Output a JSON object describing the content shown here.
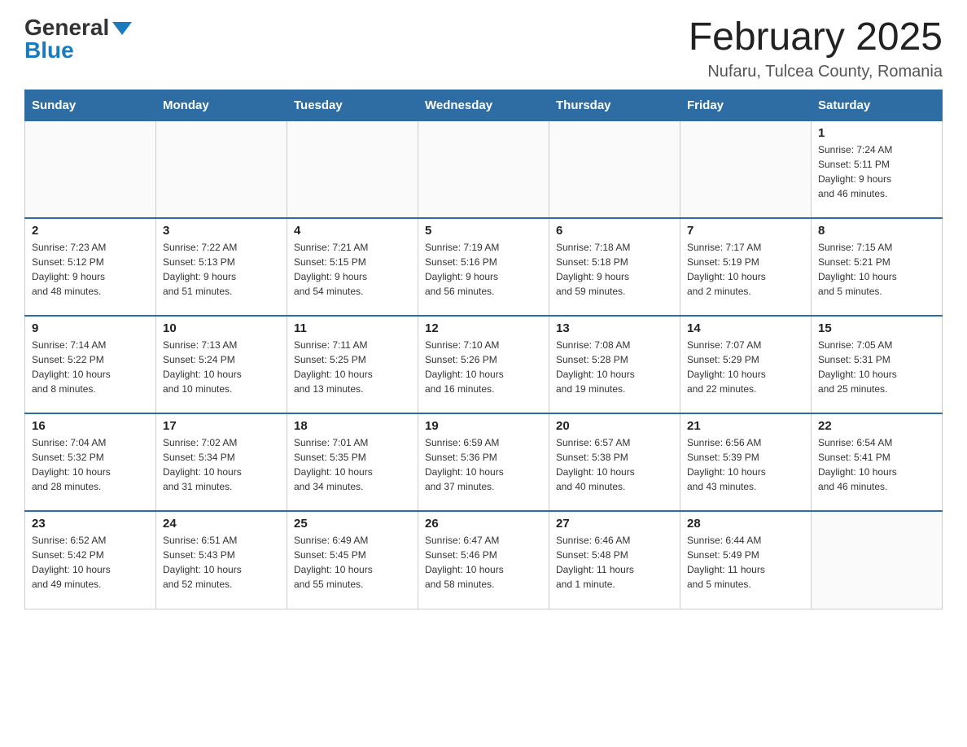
{
  "logo": {
    "general": "General",
    "blue": "Blue"
  },
  "title": "February 2025",
  "location": "Nufaru, Tulcea County, Romania",
  "weekdays": [
    "Sunday",
    "Monday",
    "Tuesday",
    "Wednesday",
    "Thursday",
    "Friday",
    "Saturday"
  ],
  "weeks": [
    [
      {
        "day": "",
        "info": ""
      },
      {
        "day": "",
        "info": ""
      },
      {
        "day": "",
        "info": ""
      },
      {
        "day": "",
        "info": ""
      },
      {
        "day": "",
        "info": ""
      },
      {
        "day": "",
        "info": ""
      },
      {
        "day": "1",
        "info": "Sunrise: 7:24 AM\nSunset: 5:11 PM\nDaylight: 9 hours\nand 46 minutes."
      }
    ],
    [
      {
        "day": "2",
        "info": "Sunrise: 7:23 AM\nSunset: 5:12 PM\nDaylight: 9 hours\nand 48 minutes."
      },
      {
        "day": "3",
        "info": "Sunrise: 7:22 AM\nSunset: 5:13 PM\nDaylight: 9 hours\nand 51 minutes."
      },
      {
        "day": "4",
        "info": "Sunrise: 7:21 AM\nSunset: 5:15 PM\nDaylight: 9 hours\nand 54 minutes."
      },
      {
        "day": "5",
        "info": "Sunrise: 7:19 AM\nSunset: 5:16 PM\nDaylight: 9 hours\nand 56 minutes."
      },
      {
        "day": "6",
        "info": "Sunrise: 7:18 AM\nSunset: 5:18 PM\nDaylight: 9 hours\nand 59 minutes."
      },
      {
        "day": "7",
        "info": "Sunrise: 7:17 AM\nSunset: 5:19 PM\nDaylight: 10 hours\nand 2 minutes."
      },
      {
        "day": "8",
        "info": "Sunrise: 7:15 AM\nSunset: 5:21 PM\nDaylight: 10 hours\nand 5 minutes."
      }
    ],
    [
      {
        "day": "9",
        "info": "Sunrise: 7:14 AM\nSunset: 5:22 PM\nDaylight: 10 hours\nand 8 minutes."
      },
      {
        "day": "10",
        "info": "Sunrise: 7:13 AM\nSunset: 5:24 PM\nDaylight: 10 hours\nand 10 minutes."
      },
      {
        "day": "11",
        "info": "Sunrise: 7:11 AM\nSunset: 5:25 PM\nDaylight: 10 hours\nand 13 minutes."
      },
      {
        "day": "12",
        "info": "Sunrise: 7:10 AM\nSunset: 5:26 PM\nDaylight: 10 hours\nand 16 minutes."
      },
      {
        "day": "13",
        "info": "Sunrise: 7:08 AM\nSunset: 5:28 PM\nDaylight: 10 hours\nand 19 minutes."
      },
      {
        "day": "14",
        "info": "Sunrise: 7:07 AM\nSunset: 5:29 PM\nDaylight: 10 hours\nand 22 minutes."
      },
      {
        "day": "15",
        "info": "Sunrise: 7:05 AM\nSunset: 5:31 PM\nDaylight: 10 hours\nand 25 minutes."
      }
    ],
    [
      {
        "day": "16",
        "info": "Sunrise: 7:04 AM\nSunset: 5:32 PM\nDaylight: 10 hours\nand 28 minutes."
      },
      {
        "day": "17",
        "info": "Sunrise: 7:02 AM\nSunset: 5:34 PM\nDaylight: 10 hours\nand 31 minutes."
      },
      {
        "day": "18",
        "info": "Sunrise: 7:01 AM\nSunset: 5:35 PM\nDaylight: 10 hours\nand 34 minutes."
      },
      {
        "day": "19",
        "info": "Sunrise: 6:59 AM\nSunset: 5:36 PM\nDaylight: 10 hours\nand 37 minutes."
      },
      {
        "day": "20",
        "info": "Sunrise: 6:57 AM\nSunset: 5:38 PM\nDaylight: 10 hours\nand 40 minutes."
      },
      {
        "day": "21",
        "info": "Sunrise: 6:56 AM\nSunset: 5:39 PM\nDaylight: 10 hours\nand 43 minutes."
      },
      {
        "day": "22",
        "info": "Sunrise: 6:54 AM\nSunset: 5:41 PM\nDaylight: 10 hours\nand 46 minutes."
      }
    ],
    [
      {
        "day": "23",
        "info": "Sunrise: 6:52 AM\nSunset: 5:42 PM\nDaylight: 10 hours\nand 49 minutes."
      },
      {
        "day": "24",
        "info": "Sunrise: 6:51 AM\nSunset: 5:43 PM\nDaylight: 10 hours\nand 52 minutes."
      },
      {
        "day": "25",
        "info": "Sunrise: 6:49 AM\nSunset: 5:45 PM\nDaylight: 10 hours\nand 55 minutes."
      },
      {
        "day": "26",
        "info": "Sunrise: 6:47 AM\nSunset: 5:46 PM\nDaylight: 10 hours\nand 58 minutes."
      },
      {
        "day": "27",
        "info": "Sunrise: 6:46 AM\nSunset: 5:48 PM\nDaylight: 11 hours\nand 1 minute."
      },
      {
        "day": "28",
        "info": "Sunrise: 6:44 AM\nSunset: 5:49 PM\nDaylight: 11 hours\nand 5 minutes."
      },
      {
        "day": "",
        "info": ""
      }
    ]
  ]
}
